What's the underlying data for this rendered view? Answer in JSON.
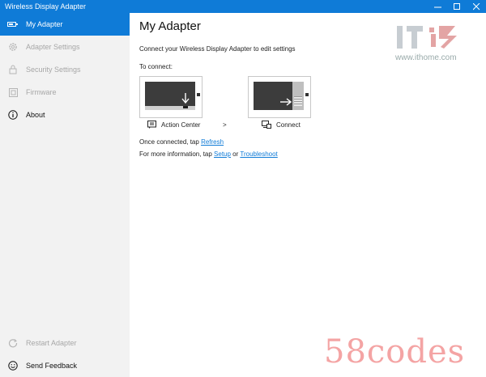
{
  "window": {
    "title": "Wireless Display Adapter"
  },
  "colors": {
    "accent": "#0f7bd7",
    "sidebar_bg": "#f2f2f2",
    "disabled_text": "#a7a7a7",
    "watermark_red": "#f4a4a4"
  },
  "sidebar": {
    "items": [
      {
        "label": "My Adapter",
        "icon": "adapter-icon",
        "state": "active"
      },
      {
        "label": "Adapter Settings",
        "icon": "gear-icon",
        "state": "disabled"
      },
      {
        "label": "Security Settings",
        "icon": "lock-icon",
        "state": "disabled"
      },
      {
        "label": "Firmware",
        "icon": "firmware-icon",
        "state": "disabled"
      },
      {
        "label": "About",
        "icon": "info-icon",
        "state": "normal"
      }
    ],
    "bottom_items": [
      {
        "label": "Restart Adapter",
        "icon": "restart-icon",
        "state": "disabled"
      },
      {
        "label": "Send Feedback",
        "icon": "smiley-icon",
        "state": "normal"
      }
    ]
  },
  "main": {
    "title": "My Adapter",
    "intro": "Connect your Wireless Display Adapter to edit settings",
    "connect_label": "To connect:",
    "steps": [
      {
        "label": "Action Center",
        "icon": "action-center-icon"
      },
      {
        "label": "Connect",
        "icon": "connect-icon"
      }
    ],
    "separator": ">",
    "line1": {
      "prefix": "Once connected, tap ",
      "link": "Refresh"
    },
    "line2": {
      "prefix": "For more information, tap ",
      "link1": "Setup",
      "middle": " or ",
      "link2": "Troubleshoot"
    }
  },
  "watermarks": {
    "it_logo": "IT之家",
    "it_url": "www.ithome.com",
    "bottom": "58codes"
  }
}
